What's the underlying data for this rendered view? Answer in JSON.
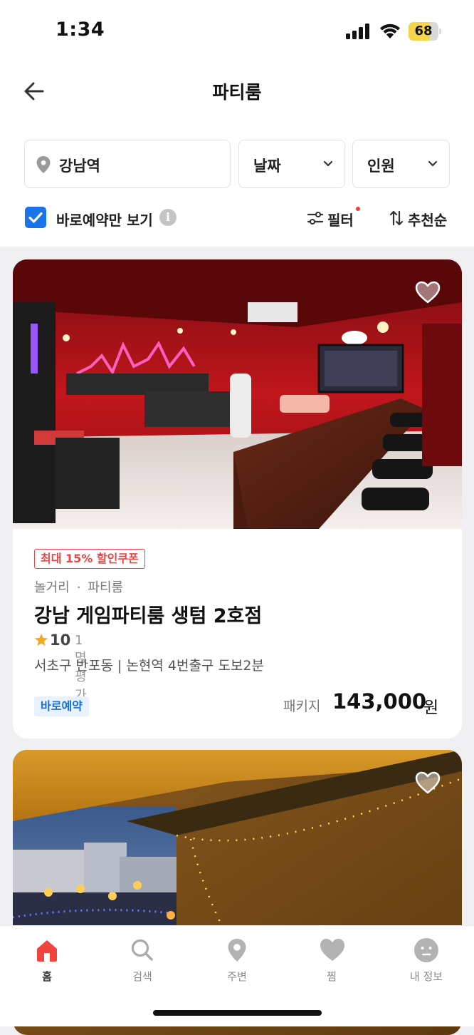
{
  "status_bar": {
    "time": "1:34",
    "battery_percent": "68",
    "battery_level": 0.68,
    "icons": [
      "cellular-signal-icon",
      "wifi-icon",
      "battery-icon"
    ]
  },
  "header": {
    "title": "파티룸",
    "back_icon": "arrow-left-icon"
  },
  "filters": {
    "location": "강남역",
    "date": "날짜",
    "people": "인원",
    "instant_only_label": "바로예약만 보기",
    "instant_only_checked": true,
    "filter_label": "필터",
    "sort_label": "추천순"
  },
  "listings": [
    {
      "coupon": "최대 15% 할인쿠폰",
      "brand": "놀거리",
      "category": "파티룸",
      "title": "강남 게임파티룸 생텀 2호점",
      "rating": "10",
      "review_count": "1명 평가",
      "address": "서초구 반포동 | 논현역 4번출구 도보2분",
      "badge": "바로예약",
      "price_label": "패키지",
      "price": "143,000",
      "price_unit": "원",
      "favorited": false
    },
    {
      "favorited": false
    }
  ],
  "tab_bar": {
    "tabs": [
      {
        "label": "홈",
        "icon": "home-icon",
        "active": true
      },
      {
        "label": "검색",
        "icon": "search-icon",
        "active": false
      },
      {
        "label": "주변",
        "icon": "location-pin-icon",
        "active": false
      },
      {
        "label": "찜",
        "icon": "heart-icon",
        "active": false
      },
      {
        "label": "내 정보",
        "icon": "profile-face-icon",
        "active": false
      }
    ]
  },
  "colors": {
    "accent_red": "#f0443e",
    "checkbox_blue": "#1a73e8",
    "coupon_red": "#ef4444",
    "badge_blue": "#1a6fd8",
    "star_yellow": "#f5a623"
  }
}
